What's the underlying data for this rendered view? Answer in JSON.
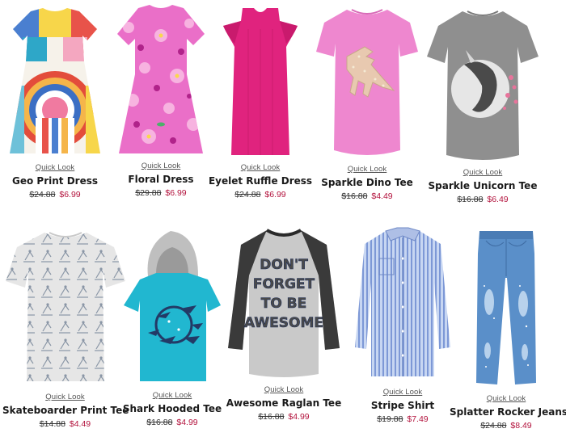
{
  "accent_sale_color": "#b3133d",
  "products": [
    {
      "name": "Geo Print Dress",
      "quick_look": "Quick Look",
      "old_price": "$24.88",
      "sale_price": "$6.99",
      "icon": "geo-print-dress-image"
    },
    {
      "name": "Floral Dress",
      "quick_look": "Quick Look",
      "old_price": "$29.88",
      "sale_price": "$6.99",
      "icon": "floral-dress-image"
    },
    {
      "name": "Eyelet Ruffle Dress",
      "quick_look": "Quick Look",
      "old_price": "$24.88",
      "sale_price": "$6.99",
      "icon": "eyelet-ruffle-dress-image"
    },
    {
      "name": "Sparkle Dino Tee",
      "quick_look": "Quick Look",
      "old_price": "$16.88",
      "sale_price": "$4.49",
      "icon": "sparkle-dino-tee-image"
    },
    {
      "name": "Sparkle Unicorn Tee",
      "quick_look": "Quick Look",
      "old_price": "$16.88",
      "sale_price": "$6.49",
      "icon": "sparkle-unicorn-tee-image"
    },
    {
      "name": "Skateboarder Print Tee",
      "quick_look": "Quick Look",
      "old_price": "$14.88",
      "sale_price": "$4.49",
      "icon": "skateboarder-print-tee-image"
    },
    {
      "name": "Shark Hooded Tee",
      "quick_look": "Quick Look",
      "old_price": "$16.88",
      "sale_price": "$4.99",
      "icon": "shark-hooded-tee-image"
    },
    {
      "name": "Awesome Raglan Tee",
      "quick_look": "Quick Look",
      "old_price": "$16.88",
      "sale_price": "$4.99",
      "icon": "awesome-raglan-tee-image",
      "print_text": [
        "DON'T",
        "FORGET",
        "TO BE",
        "AWESOME"
      ]
    },
    {
      "name": "Stripe Shirt",
      "quick_look": "Quick Look",
      "old_price": "$19.88",
      "sale_price": "$7.49",
      "icon": "stripe-shirt-image"
    },
    {
      "name": "Splatter Rocker Jeans",
      "quick_look": "Quick Look",
      "old_price": "$24.88",
      "sale_price": "$8.49",
      "icon": "splatter-rocker-jeans-image"
    }
  ]
}
